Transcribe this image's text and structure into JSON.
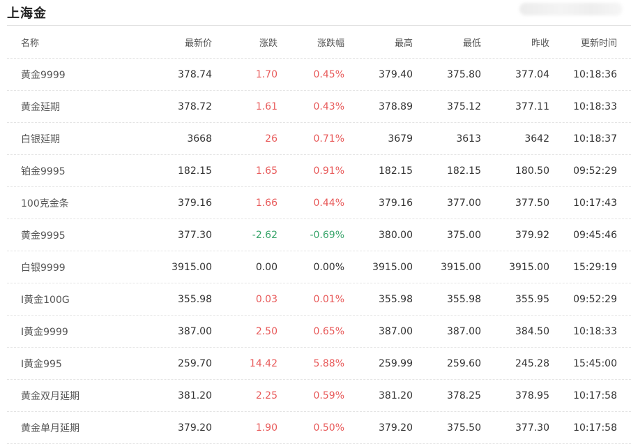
{
  "page": {
    "title": "上海金"
  },
  "colors": {
    "up": "#e85a5a",
    "down": "#39a56b",
    "flat": "#333333"
  },
  "table": {
    "headers": [
      "名称",
      "最新价",
      "涨跌",
      "涨跌幅",
      "最高",
      "最低",
      "昨收",
      "更新时间"
    ],
    "rows": [
      {
        "name": "黄金9999",
        "latest": "378.74",
        "change": "1.70",
        "pct": "0.45%",
        "high": "379.40",
        "low": "375.80",
        "prev": "377.04",
        "time": "10:18:36",
        "trend": "up"
      },
      {
        "name": "黄金延期",
        "latest": "378.72",
        "change": "1.61",
        "pct": "0.43%",
        "high": "378.89",
        "low": "375.12",
        "prev": "377.11",
        "time": "10:18:33",
        "trend": "up"
      },
      {
        "name": "白银延期",
        "latest": "3668",
        "change": "26",
        "pct": "0.71%",
        "high": "3679",
        "low": "3613",
        "prev": "3642",
        "time": "10:18:37",
        "trend": "up"
      },
      {
        "name": "铂金9995",
        "latest": "182.15",
        "change": "1.65",
        "pct": "0.91%",
        "high": "182.15",
        "low": "182.15",
        "prev": "180.50",
        "time": "09:52:29",
        "trend": "up"
      },
      {
        "name": "100克金条",
        "latest": "379.16",
        "change": "1.66",
        "pct": "0.44%",
        "high": "379.16",
        "low": "377.00",
        "prev": "377.50",
        "time": "10:17:43",
        "trend": "up"
      },
      {
        "name": "黄金9995",
        "latest": "377.30",
        "change": "-2.62",
        "pct": "-0.69%",
        "high": "380.00",
        "low": "375.00",
        "prev": "379.92",
        "time": "09:45:46",
        "trend": "down"
      },
      {
        "name": "白银9999",
        "latest": "3915.00",
        "change": "0.00",
        "pct": "0.00%",
        "high": "3915.00",
        "low": "3915.00",
        "prev": "3915.00",
        "time": "15:29:19",
        "trend": "flat"
      },
      {
        "name": "I黄金100G",
        "latest": "355.98",
        "change": "0.03",
        "pct": "0.01%",
        "high": "355.98",
        "low": "355.98",
        "prev": "355.95",
        "time": "09:52:29",
        "trend": "up"
      },
      {
        "name": "I黄金9999",
        "latest": "387.00",
        "change": "2.50",
        "pct": "0.65%",
        "high": "387.00",
        "low": "387.00",
        "prev": "384.50",
        "time": "10:18:33",
        "trend": "up"
      },
      {
        "name": "I黄金995",
        "latest": "259.70",
        "change": "14.42",
        "pct": "5.88%",
        "high": "259.99",
        "low": "259.60",
        "prev": "245.28",
        "time": "15:45:00",
        "trend": "up"
      },
      {
        "name": "黄金双月延期",
        "latest": "381.20",
        "change": "2.25",
        "pct": "0.59%",
        "high": "381.20",
        "low": "378.25",
        "prev": "378.95",
        "time": "10:17:58",
        "trend": "up"
      },
      {
        "name": "黄金单月延期",
        "latest": "379.20",
        "change": "1.90",
        "pct": "0.50%",
        "high": "379.20",
        "low": "375.50",
        "prev": "377.30",
        "time": "10:17:58",
        "trend": "up"
      }
    ]
  }
}
